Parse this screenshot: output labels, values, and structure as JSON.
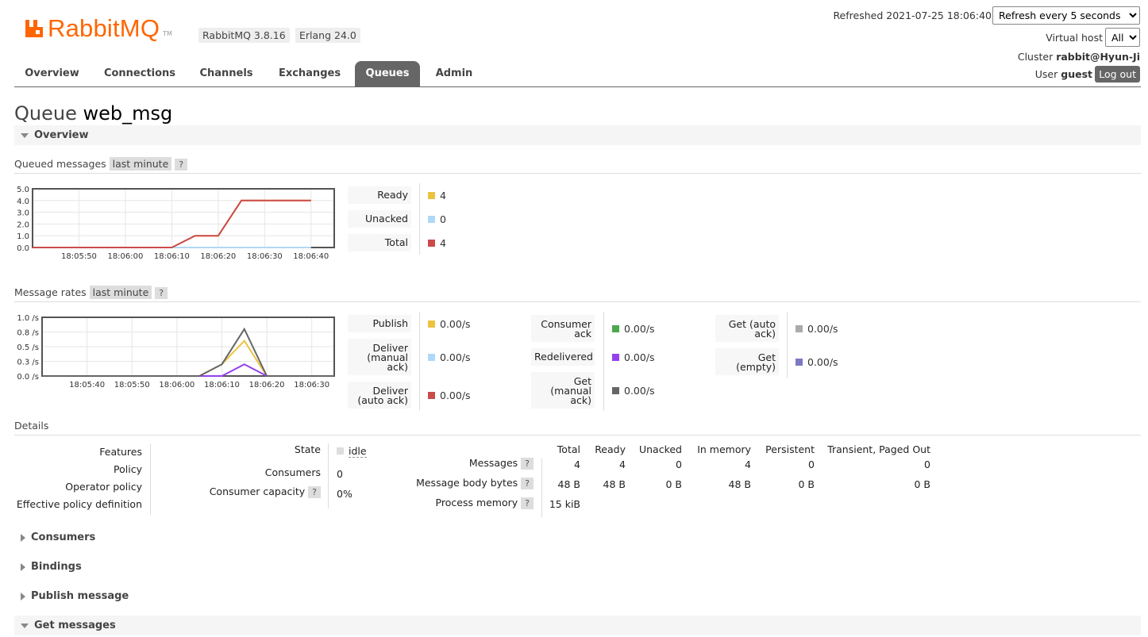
{
  "header": {
    "logo_text": "RabbitMQ",
    "logo_tm": "TM",
    "version_badge": "RabbitMQ 3.8.16",
    "erlang_badge": "Erlang 24.0",
    "refreshed_label": "Refreshed 2021-07-25 18:06:40",
    "refresh_select": "Refresh every 5 seconds",
    "vhost_label": "Virtual host",
    "vhost_select": "All",
    "cluster_label": "Cluster",
    "cluster_name": "rabbit@Hyun-Ji",
    "user_label": "User",
    "user_name": "guest",
    "logout_label": "Log out"
  },
  "nav": {
    "tabs": [
      "Overview",
      "Connections",
      "Channels",
      "Exchanges",
      "Queues",
      "Admin"
    ],
    "active": "Queues"
  },
  "page": {
    "title_prefix": "Queue",
    "queue_name": "web_msg"
  },
  "sections": {
    "overview": "Overview",
    "consumers": "Consumers",
    "bindings": "Bindings",
    "publish": "Publish message",
    "get": "Get messages"
  },
  "queued": {
    "heading": "Queued messages",
    "range": "last minute",
    "help": "?",
    "legend": [
      {
        "label": "Ready",
        "value": "4",
        "color": "#edc240"
      },
      {
        "label": "Unacked",
        "value": "0",
        "color": "#afd8f8"
      },
      {
        "label": "Total",
        "value": "4",
        "color": "#cb4b4b"
      }
    ]
  },
  "rates": {
    "heading": "Message rates",
    "range": "last minute",
    "help": "?",
    "col1": [
      {
        "label": "Publish",
        "value": "0.00/s",
        "color": "#edc240"
      },
      {
        "label": "Deliver (manual ack)",
        "value": "0.00/s",
        "color": "#afd8f8"
      },
      {
        "label": "Deliver (auto ack)",
        "value": "0.00/s",
        "color": "#cb4b4b"
      }
    ],
    "col2": [
      {
        "label": "Consumer ack",
        "value": "0.00/s",
        "color": "#4da74d"
      },
      {
        "label": "Redelivered",
        "value": "0.00/s",
        "color": "#9440ed"
      },
      {
        "label": "Get (manual ack)",
        "value": "0.00/s",
        "color": "#666666"
      }
    ],
    "col3": [
      {
        "label": "Get (auto ack)",
        "value": "0.00/s",
        "color": "#aaaaaa"
      },
      {
        "label": "Get (empty)",
        "value": "0.00/s",
        "color": "#7c79c3"
      }
    ]
  },
  "details": {
    "heading": "Details",
    "left_labels": [
      "Features",
      "Policy",
      "Operator policy",
      "Effective policy definition"
    ],
    "state_label": "State",
    "state_value": "idle",
    "consumers_label": "Consumers",
    "consumers_value": "0",
    "capacity_label": "Consumer capacity",
    "capacity_value": "0%",
    "help": "?",
    "table": {
      "columns": [
        "Total",
        "Ready",
        "Unacked",
        "In memory",
        "Persistent",
        "Transient, Paged Out"
      ],
      "rows": [
        {
          "label": "Messages",
          "values": [
            "4",
            "4",
            "0",
            "4",
            "0",
            "0"
          ]
        },
        {
          "label": "Message body bytes",
          "values": [
            "48 B",
            "48 B",
            "0 B",
            "48 B",
            "0 B",
            "0 B"
          ]
        },
        {
          "label": "Process memory",
          "values": [
            "15 kiB",
            "",
            "",
            "",
            "",
            ""
          ]
        }
      ]
    }
  },
  "chart_data": [
    {
      "type": "line",
      "ylim": [
        0,
        5
      ],
      "yticks": [
        "0.0",
        "1.0",
        "2.0",
        "3.0",
        "4.0",
        "5.0"
      ],
      "xticks": [
        "18:05:50",
        "18:06:00",
        "18:06:10",
        "18:06:20",
        "18:06:30",
        "18:06:40"
      ],
      "series": [
        {
          "name": "Unacked",
          "color": "#afd8f8",
          "x": [
            "18:05:40",
            "18:06:15",
            "18:06:20",
            "18:06:25",
            "18:06:40"
          ],
          "y": [
            0,
            0,
            0,
            0,
            0
          ]
        },
        {
          "name": "Ready",
          "color": "#edc240",
          "x": [
            "18:05:40",
            "18:06:10",
            "18:06:15",
            "18:06:20",
            "18:06:25",
            "18:06:40"
          ],
          "y": [
            0,
            0,
            1,
            1,
            4,
            4
          ]
        },
        {
          "name": "Total",
          "color": "#cb4b4b",
          "x": [
            "18:05:40",
            "18:06:10",
            "18:06:15",
            "18:06:20",
            "18:06:25",
            "18:06:40"
          ],
          "y": [
            0,
            0,
            1,
            1,
            4,
            4
          ]
        }
      ]
    },
    {
      "type": "line",
      "ylim": [
        0,
        1.0
      ],
      "yticks": [
        "0.0 /s",
        "0.3 /s",
        "0.5 /s",
        "0.8 /s",
        "1.0 /s"
      ],
      "xticks": [
        "18:05:40",
        "18:05:50",
        "18:06:00",
        "18:06:10",
        "18:06:20",
        "18:06:30"
      ],
      "series": [
        {
          "name": "Publish",
          "color": "#edc240",
          "x": [
            "18:05:30",
            "18:06:05",
            "18:06:10",
            "18:06:15",
            "18:06:20",
            "18:06:35"
          ],
          "y": [
            0,
            0,
            0.2,
            0.6,
            0,
            0
          ]
        },
        {
          "name": "Redelivered",
          "color": "#9440ed",
          "x": [
            "18:05:30",
            "18:06:10",
            "18:06:15",
            "18:06:20",
            "18:06:35"
          ],
          "y": [
            0,
            0,
            0.2,
            0,
            0
          ]
        },
        {
          "name": "Get (manual ack)",
          "color": "#666666",
          "x": [
            "18:05:30",
            "18:06:05",
            "18:06:10",
            "18:06:15",
            "18:06:20",
            "18:06:35"
          ],
          "y": [
            0,
            0,
            0.2,
            0.8,
            0,
            0
          ]
        }
      ]
    }
  ]
}
